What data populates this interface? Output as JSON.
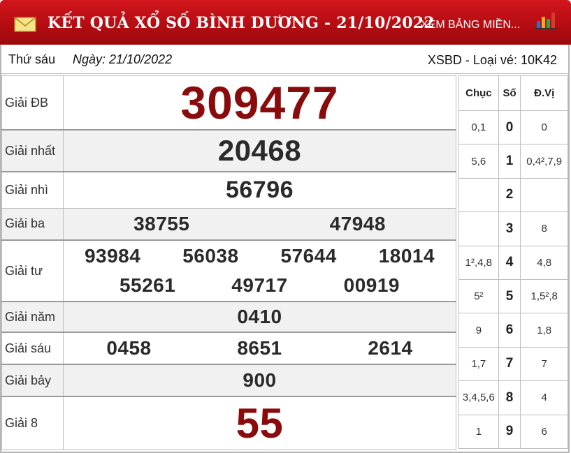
{
  "header": {
    "title": "KẾT QUẢ XỔ SỐ BÌNH DƯƠNG - 21/10/2022",
    "link_label": "XEM BẢNG MIỀN...",
    "color": "#c0141a"
  },
  "info": {
    "weekday": "Thứ sáu",
    "date": "Ngày: 21/10/2022",
    "code": "XSBD - Loại vé: 10K42"
  },
  "prizes": [
    {
      "label": "Giải ĐB",
      "numbers": [
        "309477"
      ]
    },
    {
      "label": "Giải nhất",
      "numbers": [
        "20468"
      ]
    },
    {
      "label": "Giải nhì",
      "numbers": [
        "56796"
      ]
    },
    {
      "label": "Giải ba",
      "numbers": [
        "38755",
        "47948"
      ]
    },
    {
      "label": "Giải tư",
      "numbers": [
        "93984",
        "56038",
        "57644",
        "18014",
        "55261",
        "49717",
        "00919"
      ]
    },
    {
      "label": "Giải năm",
      "numbers": [
        "0410"
      ]
    },
    {
      "label": "Giải sáu",
      "numbers": [
        "0458",
        "8651",
        "2614"
      ]
    },
    {
      "label": "Giải bảy",
      "numbers": [
        "900"
      ]
    },
    {
      "label": "Giải 8",
      "numbers": [
        "55"
      ]
    }
  ],
  "loto": {
    "headers": [
      "Chục",
      "Số",
      "Đ.Vị"
    ],
    "rows": [
      {
        "chuc": "0,1",
        "so": "0",
        "dv": "0"
      },
      {
        "chuc": "5,6",
        "so": "1",
        "dv": "0,4²,7,9"
      },
      {
        "chuc": "",
        "so": "2",
        "dv": ""
      },
      {
        "chuc": "",
        "so": "3",
        "dv": "8"
      },
      {
        "chuc": "1²,4,8",
        "so": "4",
        "dv": "4,8"
      },
      {
        "chuc": "5²",
        "so": "5",
        "dv": "1,5²,8"
      },
      {
        "chuc": "9",
        "so": "6",
        "dv": "1,8"
      },
      {
        "chuc": "1,7",
        "so": "7",
        "dv": "7"
      },
      {
        "chuc": "3,4,5,6",
        "so": "8",
        "dv": "4"
      },
      {
        "chuc": "1",
        "so": "9",
        "dv": "6"
      }
    ]
  }
}
